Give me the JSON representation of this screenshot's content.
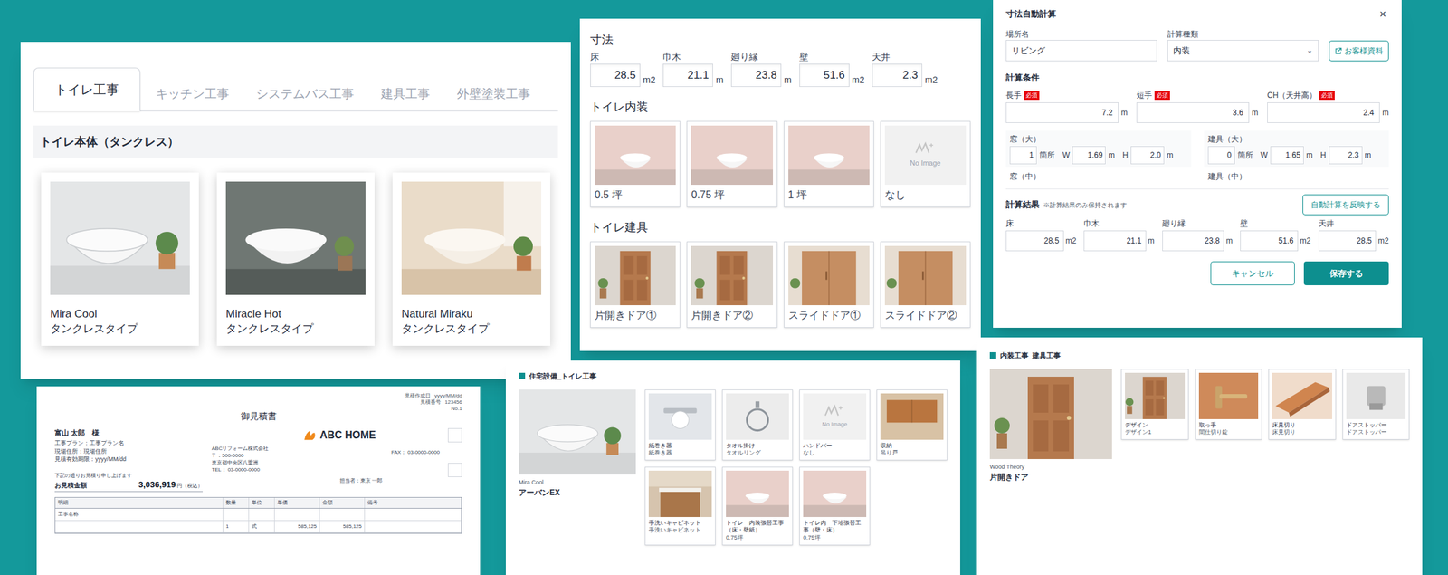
{
  "no_image": "No Image",
  "work_panel": {
    "tabs": [
      {
        "label": "トイレ工事",
        "selected": true
      },
      {
        "label": "キッチン工事",
        "selected": false
      },
      {
        "label": "システムバス工事",
        "selected": false
      },
      {
        "label": "建具工事",
        "selected": false
      },
      {
        "label": "外壁塗装工事",
        "selected": false
      }
    ],
    "section_title": "トイレ本体（タンクレス）",
    "products": [
      {
        "name": "Mira Cool",
        "type": "タンクレスタイプ",
        "kind": "toilet"
      },
      {
        "name": "Miracle Hot",
        "type": "タンクレスタイプ",
        "kind": "toilet-dark"
      },
      {
        "name": "Natural Miraku",
        "type": "タンクレスタイプ",
        "kind": "toilet-warm"
      }
    ]
  },
  "dimensions_panel": {
    "title": "寸法",
    "fields": [
      {
        "label": "床",
        "value": "28.5",
        "unit": "m2"
      },
      {
        "label": "巾木",
        "value": "21.1",
        "unit": "m"
      },
      {
        "label": "廻り縁",
        "value": "23.8",
        "unit": "m"
      },
      {
        "label": "壁",
        "value": "51.6",
        "unit": "m2"
      },
      {
        "label": "天井",
        "value": "2.3",
        "unit": "m2"
      }
    ],
    "interior": {
      "title": "トイレ内装",
      "options": [
        {
          "label": "0.5 坪",
          "kind": "room"
        },
        {
          "label": "0.75 坪",
          "kind": "room"
        },
        {
          "label": "1 坪",
          "kind": "room"
        },
        {
          "label": "なし",
          "kind": "none"
        }
      ]
    },
    "doors": {
      "title": "トイレ建具",
      "options": [
        {
          "label": "片開きドア①",
          "kind": "door"
        },
        {
          "label": "片開きドア②",
          "kind": "door"
        },
        {
          "label": "スライドドア①",
          "kind": "sliding"
        },
        {
          "label": "スライドドア②",
          "kind": "sliding"
        }
      ]
    }
  },
  "calc_modal": {
    "title": "寸法自動計算",
    "close": "×",
    "place": {
      "label": "場所名",
      "value": "リビング"
    },
    "calc_type": {
      "label": "計算種類",
      "value": "内装",
      "arrow": "⌄"
    },
    "customer_button": "お客様資料",
    "conditions_title": "計算条件",
    "required_badge": "必須",
    "dims": [
      {
        "label": "長手",
        "value": "7.2",
        "unit": "m",
        "required": true
      },
      {
        "label": "短手",
        "value": "3.6",
        "unit": "m",
        "required": true
      },
      {
        "label": "CH（天井高）",
        "value": "2.4",
        "unit": "m",
        "required": true
      }
    ],
    "w_label": "W",
    "h_label": "H",
    "count_unit": "箇所",
    "len_unit": "m",
    "openings": [
      {
        "label": "窓（大）",
        "count": "1",
        "w": "1.69",
        "h": "2.0"
      },
      {
        "label": "建具（大）",
        "count": "0",
        "w": "1.65",
        "h": "2.3"
      }
    ],
    "more_openings": [
      "窓（中）",
      "建具（中）"
    ],
    "apply_button": "自動計算を反映する",
    "results_title": "計算結果",
    "results_note": "※計算結果のみ保持されます",
    "results": [
      {
        "label": "床",
        "value": "28.5",
        "unit": "m2"
      },
      {
        "label": "巾木",
        "value": "21.1",
        "unit": "m"
      },
      {
        "label": "廻り縁",
        "value": "23.8",
        "unit": "m"
      },
      {
        "label": "壁",
        "value": "51.6",
        "unit": "m2"
      },
      {
        "label": "天井",
        "value": "28.5",
        "unit": "m2"
      }
    ],
    "cancel": "キャンセル",
    "save": "保存する"
  },
  "estimate": {
    "meta": [
      {
        "label": "見積作成日",
        "value": "yyyy/MM/dd"
      },
      {
        "label": "見積番号",
        "value": "123456"
      }
    ],
    "page": "No.1",
    "title": "御見積書",
    "customer": "富山 太郎　様",
    "info": [
      {
        "label": "工事プラン：",
        "value": "工事プラン名"
      },
      {
        "label": "現場住所：",
        "value": "現場住所"
      },
      {
        "label": "見積有効期限：",
        "value": "yyyy/MM/dd"
      }
    ],
    "logo": "ABC HOME",
    "company": [
      "ABCリフォーム株式会社",
      "〒：500-0000",
      "東京都中央区八重洲",
      "TEL： 03-0000-0000"
    ],
    "fax": "FAX： 03-0000-0000",
    "staff": "担当者：東京 一郎",
    "lead": "下記の通りお見積り申し上げます",
    "amount_label": "お見積金額",
    "amount": "3,036,919",
    "amount_unit": "円（税込）",
    "columns": [
      "明細",
      "数量",
      "単位",
      "単価",
      "金額",
      "備考"
    ],
    "rows": [
      [
        "工事名称",
        "",
        "",
        "",
        "",
        ""
      ],
      [
        "",
        "1",
        "式",
        "585,125",
        "585,125",
        ""
      ]
    ]
  },
  "toilet_equipment": {
    "title": "住宅設備_トイレ工事",
    "main": {
      "brand": "Mira Cool",
      "name": "アーバンEX",
      "kind": "toilet"
    },
    "options": [
      {
        "label": "紙巻き器",
        "value": "紙巻き器",
        "kind": "paper"
      },
      {
        "label": "タオル掛け",
        "value": "タオルリング",
        "kind": "towel"
      },
      {
        "label": "ハンドバー",
        "value": "なし",
        "kind": "none"
      },
      {
        "label": "収納",
        "value": "吊り戸",
        "kind": "cabinet"
      },
      {
        "label": "手洗いキャビネット",
        "value": "手洗いキャビネット",
        "kind": "sink"
      },
      {
        "label": "トイレ　内装張替工事（床・壁紙）",
        "value": "0.75坪",
        "kind": "room"
      },
      {
        "label": "トイレ内　下地張替工事（壁・床）",
        "value": "0.75坪",
        "kind": "room"
      }
    ]
  },
  "door_work": {
    "title": "内装工事_建具工事",
    "main": {
      "brand": "Wood Theory",
      "name": "片開きドア",
      "kind": "door"
    },
    "options": [
      {
        "label": "デザイン",
        "value": "デザイン1",
        "kind": "door"
      },
      {
        "label": "取っ手",
        "value": "間仕切り錠",
        "kind": "handle"
      },
      {
        "label": "床見切り",
        "value": "床見切り",
        "kind": "trim"
      },
      {
        "label": "ドアストッパー",
        "value": "ドアストッパー",
        "kind": "stopper"
      }
    ]
  }
}
